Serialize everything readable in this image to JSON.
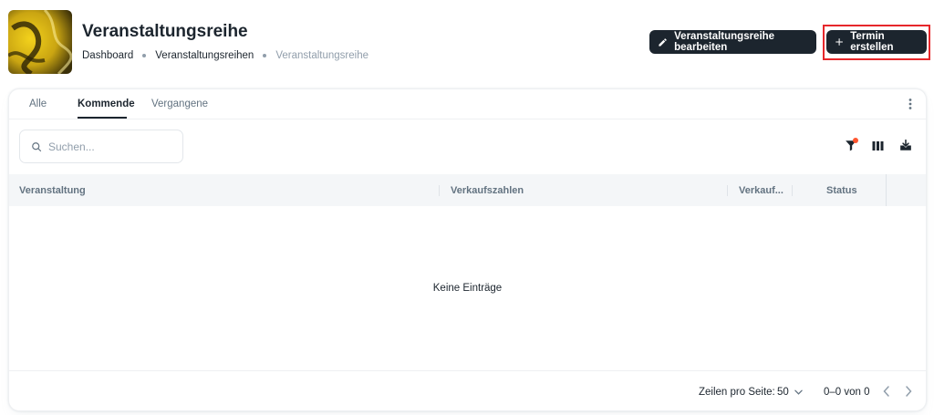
{
  "header": {
    "title": "Veranstaltungsreihe",
    "breadcrumbs": [
      "Dashboard",
      "Veranstaltungsreihen",
      "Veranstaltungsreihe"
    ],
    "edit_button_label": "Veranstaltungsreihe bearbeiten",
    "create_button_label": "Termin erstellen"
  },
  "tabs": [
    {
      "label": "Alle",
      "active": false
    },
    {
      "label": "Kommende",
      "active": true
    },
    {
      "label": "Vergangene",
      "active": false
    }
  ],
  "toolbar": {
    "search_placeholder": "Suchen...",
    "icons": [
      "filter-icon",
      "columns-icon",
      "export-icon"
    ]
  },
  "table": {
    "columns": [
      "Veranstaltung",
      "Verkaufszahlen",
      "Verkauf...",
      "Status"
    ],
    "empty_text": "Keine Einträge"
  },
  "pagination": {
    "rows_per_page_label": "Zeilen pro Seite:",
    "rows_per_page_value": "50",
    "range_text": "0–0 von 0"
  },
  "colors": {
    "primary": "#1c252e",
    "highlight": "#e6272b",
    "filter_badge": "#ff5630",
    "header_bg": "#f4f6f8",
    "muted_text": "#637381"
  }
}
